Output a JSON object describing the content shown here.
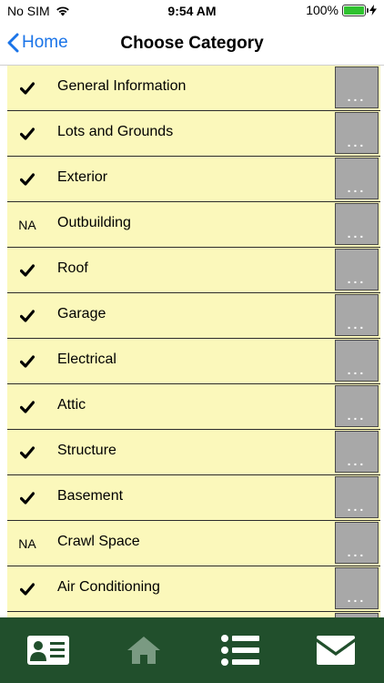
{
  "status_bar": {
    "carrier": "No SIM",
    "time": "9:54 AM",
    "battery_percent": "100%",
    "battery_level": 1.0
  },
  "nav": {
    "back_label": "Home",
    "title": "Choose Category"
  },
  "more_label": "...",
  "categories": [
    {
      "status": "check",
      "status_text": "",
      "label": "General Information"
    },
    {
      "status": "check",
      "status_text": "",
      "label": "Lots and Grounds"
    },
    {
      "status": "check",
      "status_text": "",
      "label": "Exterior"
    },
    {
      "status": "na",
      "status_text": "NA",
      "label": "Outbuilding"
    },
    {
      "status": "check",
      "status_text": "",
      "label": "Roof"
    },
    {
      "status": "check",
      "status_text": "",
      "label": "Garage"
    },
    {
      "status": "check",
      "status_text": "",
      "label": "Electrical"
    },
    {
      "status": "check",
      "status_text": "",
      "label": "Attic"
    },
    {
      "status": "check",
      "status_text": "",
      "label": "Structure"
    },
    {
      "status": "check",
      "status_text": "",
      "label": "Basement"
    },
    {
      "status": "na",
      "status_text": "NA",
      "label": "Crawl Space"
    },
    {
      "status": "check",
      "status_text": "",
      "label": "Air Conditioning"
    },
    {
      "status": "check",
      "status_text": "",
      "label": ""
    }
  ],
  "tab_bar": {
    "tabs": [
      {
        "name": "contact-card-icon",
        "color": "#ffffff"
      },
      {
        "name": "home-icon",
        "color": "#7a9a82"
      },
      {
        "name": "list-icon",
        "color": "#ffffff"
      },
      {
        "name": "envelope-icon",
        "color": "#ffffff"
      }
    ]
  },
  "colors": {
    "accent": "#1a74e8",
    "row_bg": "#fbf8bb",
    "tab_bar_bg": "#214f2c",
    "battery": "#2fc22f"
  }
}
